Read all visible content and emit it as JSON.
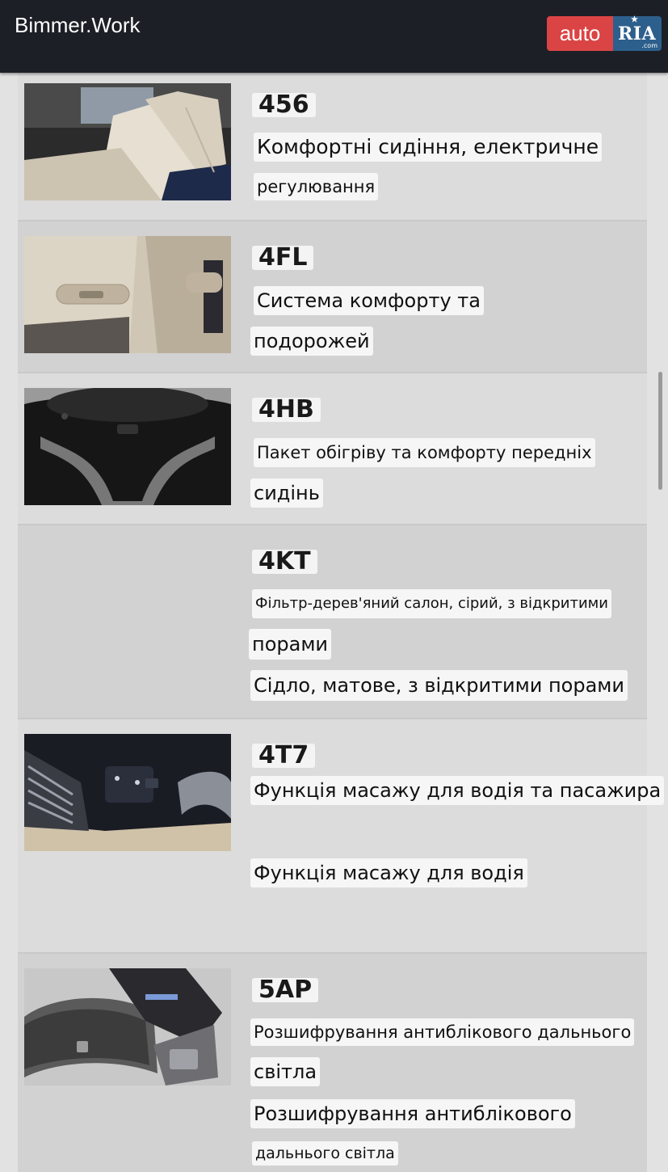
{
  "header": {
    "title": "Bimmer.Work",
    "logo_auto": "auto",
    "logo_ria": "RIA",
    "logo_com": ".com"
  },
  "options": [
    {
      "code": "456",
      "lines": [
        "Комфортні сидіння, електричне",
        "регулювання"
      ],
      "image": "leather-seat-photo"
    },
    {
      "code": "4FL",
      "lines": [
        "Система комфорту та",
        "подорожей"
      ],
      "image": "seat-back-photo"
    },
    {
      "code": "4HB",
      "lines": [
        "Пакет обігріву та комфорту передніх",
        "сидінь"
      ],
      "image": "steering-wheel-photo"
    },
    {
      "code": "4KT",
      "lines": [
        "Фільтр-дерев'яний салон, сірий, з відкритими",
        "порами",
        "Сідло, матове, з відкритими порами"
      ],
      "image": ""
    },
    {
      "code": "4T7",
      "lines": [
        "Функція масажу для водія та пасажира",
        "Функція масажу для водія"
      ],
      "image": "door-controls-photo"
    },
    {
      "code": "5AP",
      "lines": [
        "Розшифрування антиблікового дальнього",
        "світла",
        "Розшифрування антиблікового",
        "дальнього світла"
      ],
      "image": "rear-mirror-camera-photo"
    }
  ],
  "colors": {
    "topbar": "#1c1f26",
    "logo_red": "#db4444",
    "logo_blue": "#2d5f8c",
    "row_bg": "#dcdcdc"
  }
}
